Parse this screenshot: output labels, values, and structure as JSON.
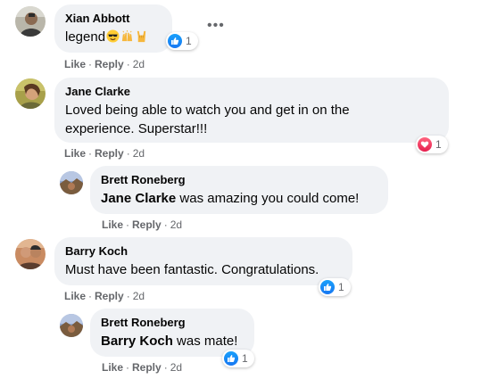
{
  "comments": [
    {
      "author": "Xian Abbott",
      "text": "legend",
      "emojis": [
        "sunglasses-face-emoji",
        "raising-hands-emoji",
        "sign-of-the-horns-emoji"
      ],
      "actions": {
        "like": "Like",
        "reply": "Reply",
        "time": "2d"
      },
      "reaction": {
        "type": "like",
        "count": "1"
      },
      "more_icon": "more-options-icon"
    },
    {
      "author": "Jane Clarke",
      "text_line1": "Loved being able to watch you and get in on the",
      "text_line2": "experience. Superstar!!!",
      "actions": {
        "like": "Like",
        "reply": "Reply",
        "time": "2d"
      },
      "reaction": {
        "type": "love",
        "count": "1"
      }
    },
    {
      "author": "Brett Roneberg",
      "mention": "Jane Clarke",
      "text": " was amazing you could come!",
      "actions": {
        "like": "Like",
        "reply": "Reply",
        "time": "2d"
      }
    },
    {
      "author": "Barry Koch",
      "text": "Must have been fantastic. Congratulations.",
      "actions": {
        "like": "Like",
        "reply": "Reply",
        "time": "2d"
      },
      "reaction": {
        "type": "like",
        "count": "1"
      }
    },
    {
      "author": "Brett Roneberg",
      "mention": "Barry Koch",
      "text": " was mate!",
      "actions": {
        "like": "Like",
        "reply": "Reply",
        "time": "2d"
      },
      "reaction": {
        "type": "like",
        "count": "1"
      }
    }
  ],
  "separator": "·",
  "colors": {
    "bubble": "#f0f2f5",
    "meta_text": "#65676b",
    "like_blue": "#1877f2",
    "love_red": "#e61e4d"
  }
}
